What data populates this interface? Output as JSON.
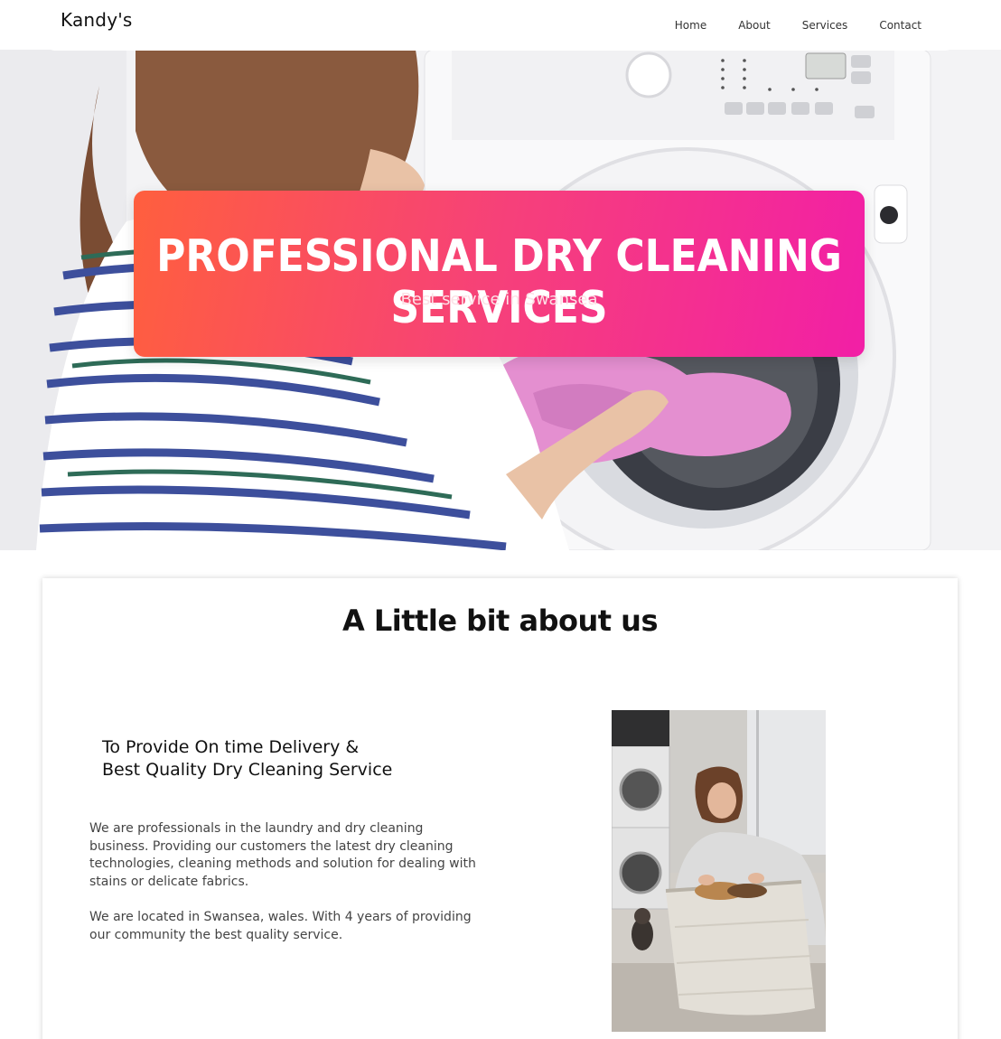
{
  "nav": {
    "logo": "Kandy's",
    "links": [
      "Home",
      "About",
      "Services",
      "Contact"
    ]
  },
  "hero": {
    "title": "PROFESSIONAL DRY CLEANING SERVICES",
    "subtitle": "Best service in Swansea",
    "image": "woman-loading-washing-machine-photo"
  },
  "about": {
    "title": "A Little bit about us",
    "heading_line1": "To Provide On time Delivery &",
    "heading_line2": "Best Quality Dry Cleaning Service",
    "paragraph1": "We are professionals in the laundry and dry cleaning business. Providing our customers the latest dry cleaning technologies, cleaning methods and solution for dealing with stains or delicate fabrics.",
    "paragraph2": "We are located in Swansea, wales. With 4 years of providing our community the best quality service.",
    "image": "woman-with-laundry-basket-photo"
  },
  "colors": {
    "gradient_start": "#ff5f3e",
    "gradient_end": "#f21fa6",
    "text_dark": "#111111"
  }
}
